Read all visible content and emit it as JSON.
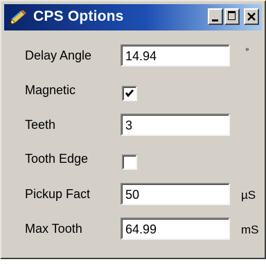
{
  "window": {
    "title": "CPS Options",
    "icon": "pencil-icon",
    "controls": [
      "minimize-icon",
      "maximize-icon",
      "close-icon"
    ]
  },
  "fields": {
    "delay_angle": {
      "label": "Delay Angle",
      "value": "14.94",
      "unit": "°"
    },
    "magnetic": {
      "label": "Magnetic",
      "checked": true
    },
    "teeth": {
      "label": "Teeth",
      "value": "3"
    },
    "tooth_edge": {
      "label": "Tooth Edge",
      "checked": false
    },
    "pickup_fact": {
      "label": "Pickup Fact",
      "value": "50",
      "unit": "µS"
    },
    "max_tooth": {
      "label": "Max Tooth",
      "value": "64.99",
      "unit": "mS"
    }
  },
  "colors": {
    "title_start": "#0a246a",
    "title_end": "#a6caf0",
    "face": "#d4d0c8"
  }
}
